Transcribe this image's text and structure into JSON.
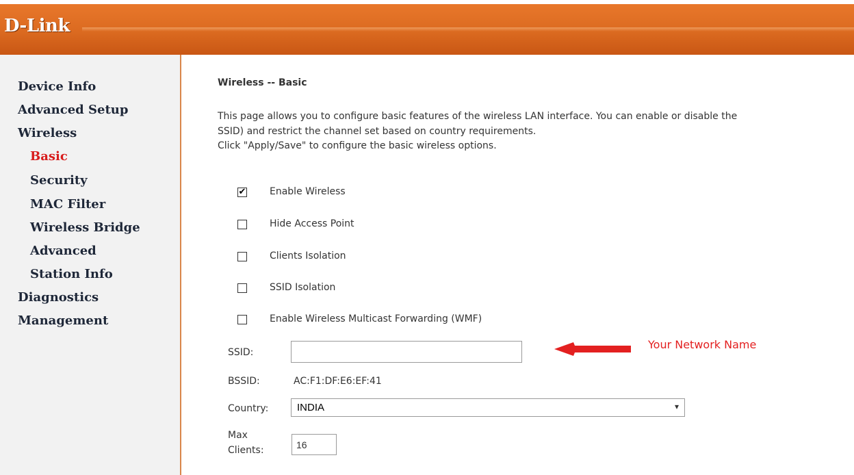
{
  "header": {
    "logo": "D-Link",
    "colors": {
      "bar": "#db6a20",
      "logo_text": "#ffffff"
    }
  },
  "sidebar": {
    "items": [
      {
        "label": "Device Info",
        "level": 0
      },
      {
        "label": "Advanced Setup",
        "level": 0
      },
      {
        "label": "Wireless",
        "level": 0
      },
      {
        "label": "Basic",
        "level": 1,
        "active": true
      },
      {
        "label": "Security",
        "level": 1
      },
      {
        "label": "MAC Filter",
        "level": 1
      },
      {
        "label": "Wireless Bridge",
        "level": 1
      },
      {
        "label": "Advanced",
        "level": 1
      },
      {
        "label": "Station Info",
        "level": 1
      },
      {
        "label": "Diagnostics",
        "level": 0
      },
      {
        "label": "Management",
        "level": 0
      }
    ],
    "colors": {
      "text": "#1e2738",
      "active": "#d81c1c"
    }
  },
  "main": {
    "title": "Wireless -- Basic",
    "description": [
      "This page allows you to configure basic features of the wireless LAN interface. You can enable or disable the",
      "SSID) and restrict the channel set based on country requirements.",
      "Click \"Apply/Save\" to configure the basic wireless options."
    ],
    "options": [
      {
        "label": "Enable Wireless",
        "checked": true
      },
      {
        "label": "Hide Access Point",
        "checked": false
      },
      {
        "label": "Clients Isolation",
        "checked": false
      },
      {
        "label": "SSID Isolation",
        "checked": false
      },
      {
        "label": "Enable Wireless Multicast Forwarding (WMF)",
        "checked": false
      }
    ],
    "ssid": {
      "label": "SSID:",
      "value": ""
    },
    "bssid": {
      "label": "BSSID:",
      "value": "AC:F1:DF:E6:EF:41"
    },
    "country": {
      "label": "Country:",
      "value": "INDIA"
    },
    "max_clients": {
      "label_line1": "Max",
      "label_line2": "Clients:",
      "value": "16"
    }
  },
  "annotation": {
    "text": "Your Network Name",
    "color": "#e32020"
  },
  "icons": {
    "checkbox_checked": "check-mark",
    "select_arrow": "chevron-down",
    "annotation_arrow": "arrow-left"
  }
}
